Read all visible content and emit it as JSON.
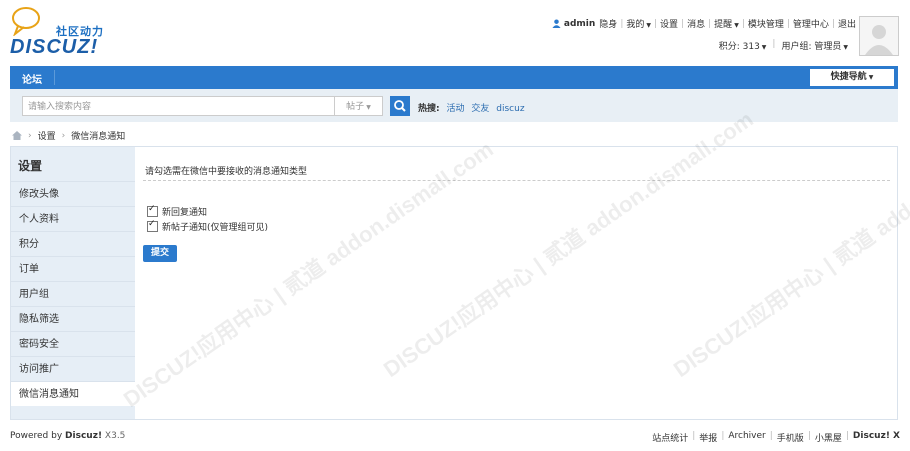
{
  "logo": {
    "sub": "社区动力",
    "main": "DISCUZ!"
  },
  "topnav": {
    "user": "admin",
    "items": [
      "隐身",
      "我的",
      "设置",
      "消息",
      "提醒",
      "模块管理",
      "管理中心",
      "退出"
    ],
    "credits": "积分: 313",
    "usergroup": "用户组: 管理员"
  },
  "nav": {
    "forum": "论坛",
    "quicknav": "快捷导航"
  },
  "search": {
    "placeholder": "请输入搜索内容",
    "type": "帖子",
    "hot_label": "热搜:",
    "hot": [
      "活动",
      "交友",
      "discuz"
    ]
  },
  "breadcrumb": [
    "设置",
    "微信消息通知"
  ],
  "sidebar": {
    "title": "设置",
    "items": [
      "修改头像",
      "个人资料",
      "积分",
      "订单",
      "用户组",
      "隐私筛选",
      "密码安全",
      "访问推广",
      "微信消息通知"
    ]
  },
  "main": {
    "intro": "请勾选需在微信中要接收的消息通知类型",
    "options": [
      "新回复通知",
      "新帖子通知(仅管理组可见)"
    ],
    "submit": "提交"
  },
  "watermark": "DISCUZ!应用中心 | 贰道 addon.dismall.com",
  "footer": {
    "powered_prefix": "Powered by",
    "powered_brand": "Discuz!",
    "powered_version": "X3.5",
    "links": [
      "站点统计",
      "举报",
      "Archiver",
      "手机版",
      "小黑屋"
    ],
    "brand": "Discuz! X"
  },
  "colors": {
    "accent": "#2b7acd",
    "sidebar": "#e6eef6",
    "searchbar": "#e8eff5"
  }
}
